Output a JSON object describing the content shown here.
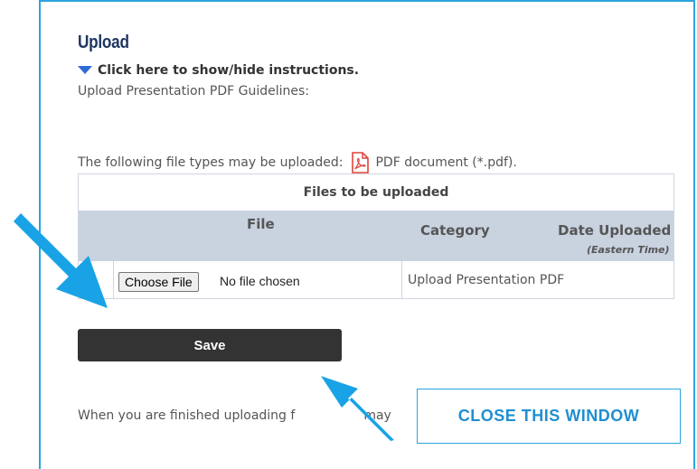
{
  "upload": {
    "heading": "Upload",
    "instructions_toggle": "Click here to show/hide instructions.",
    "guidelines": "Upload Presentation PDF Guidelines:",
    "filetypes_prefix": "The following file types may be uploaded:",
    "filetype": "PDF document (*.pdf)."
  },
  "table": {
    "title": "Files to be uploaded",
    "headers": {
      "file": "File",
      "category": "Category",
      "date": "Date Uploaded",
      "date_note": "(Eastern Time)"
    },
    "row": {
      "choose_label": "Choose File",
      "file_status": "No file chosen",
      "category": "Upload Presentation PDF"
    }
  },
  "actions": {
    "save_label": "Save",
    "finished_text": "When you are finished uploading f",
    "finished_tail": "may",
    "close_label": "CLOSE THIS WINDOW"
  },
  "colors": {
    "accent": "#2aa5dd",
    "arrow": "#19a3e6",
    "header_bg": "#c9d2df",
    "save_bg": "#333333"
  }
}
